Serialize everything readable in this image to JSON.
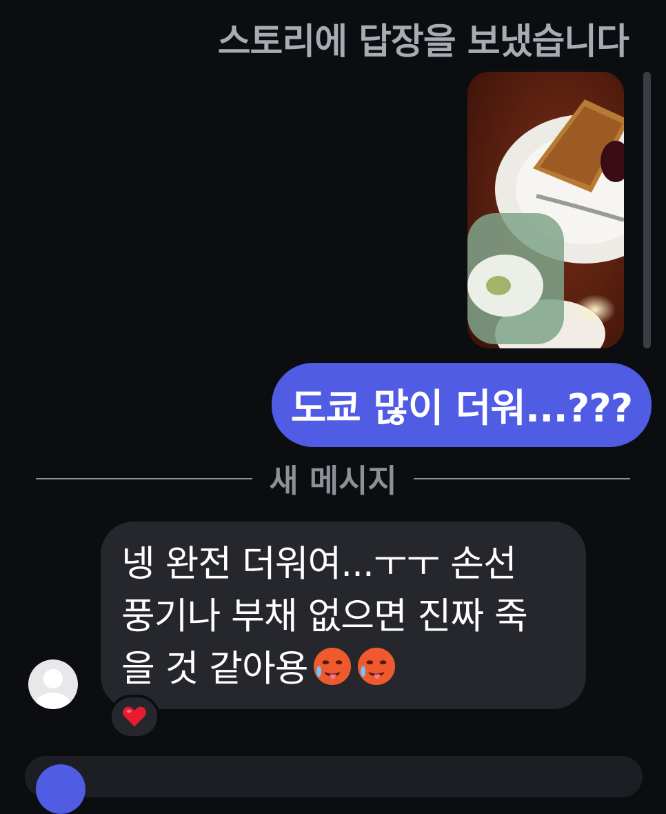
{
  "story_reply_header": "스토리에 답장을 보냈습니다",
  "outgoing_message": "도쿄 많이 더워...???",
  "new_messages_divider": "새 메시지",
  "incoming_message": {
    "line1": "넹 완전 더워여...ㅜㅜ 손선",
    "line2": "풍기나 부채 없으면 진짜 죽",
    "line3": "을 것 같아용",
    "emojis": [
      "hot-face-emoji",
      "hot-face-emoji"
    ]
  },
  "reaction": "heart-emoji",
  "colors": {
    "background": "#0b0d11",
    "outgoing_bubble": "#4f5ce3",
    "incoming_bubble": "#25272d",
    "muted_text": "#8c9097"
  }
}
